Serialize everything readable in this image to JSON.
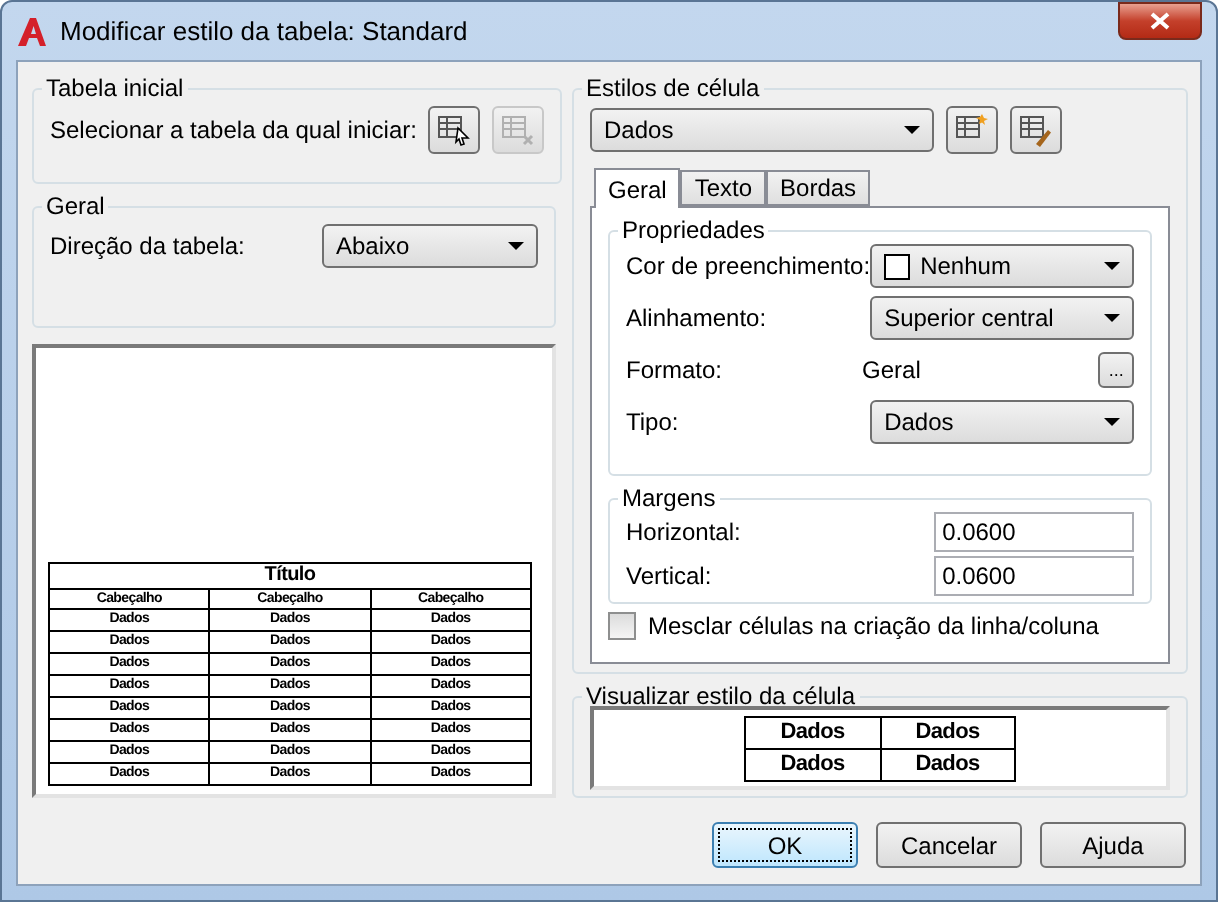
{
  "window": {
    "title": "Modificar estilo da tabela: Standard"
  },
  "initial_table": {
    "title": "Tabela inicial",
    "label": "Selecionar a tabela da qual iniciar:"
  },
  "general": {
    "title": "Geral",
    "label": "Direção da tabela:",
    "value": "Abaixo"
  },
  "preview": {
    "title": "Título",
    "headers": [
      "Cabeçalho",
      "Cabeçalho",
      "Cabeçalho"
    ],
    "rows": [
      [
        "Dados",
        "Dados",
        "Dados"
      ],
      [
        "Dados",
        "Dados",
        "Dados"
      ],
      [
        "Dados",
        "Dados",
        "Dados"
      ],
      [
        "Dados",
        "Dados",
        "Dados"
      ],
      [
        "Dados",
        "Dados",
        "Dados"
      ],
      [
        "Dados",
        "Dados",
        "Dados"
      ],
      [
        "Dados",
        "Dados",
        "Dados"
      ],
      [
        "Dados",
        "Dados",
        "Dados"
      ]
    ]
  },
  "cell_styles": {
    "title": "Estilos de célula",
    "value": "Dados"
  },
  "tabs": [
    {
      "label": "Geral",
      "selected": true
    },
    {
      "label": "Texto",
      "selected": false
    },
    {
      "label": "Bordas",
      "selected": false
    }
  ],
  "properties": {
    "title": "Propriedades",
    "fields": [
      {
        "kind": "swatch",
        "label": "Cor de preenchimento:",
        "value": "Nenhum"
      },
      {
        "kind": "dropdown",
        "label": "Alinhamento:",
        "value": "Superior central"
      },
      {
        "kind": "browse",
        "label": "Formato:",
        "value": "Geral",
        "button": "..."
      },
      {
        "kind": "dropdown",
        "label": "Tipo:",
        "value": "Dados"
      }
    ]
  },
  "margins": {
    "title": "Margens",
    "fields": [
      {
        "label": "Horizontal:",
        "value": "0.0600"
      },
      {
        "label": "Vertical:",
        "value": "0.0600"
      }
    ]
  },
  "merge": {
    "label": "Mesclar células na criação da linha/coluna",
    "checked": false
  },
  "cell_preview": {
    "title": "Visualizar estilo da célula",
    "rows": [
      [
        "Dados",
        "Dados"
      ],
      [
        "Dados",
        "Dados"
      ]
    ]
  },
  "buttons": [
    {
      "label": "OK",
      "default": true
    },
    {
      "label": "Cancelar",
      "default": false
    },
    {
      "label": "Ajuda",
      "default": false
    }
  ]
}
